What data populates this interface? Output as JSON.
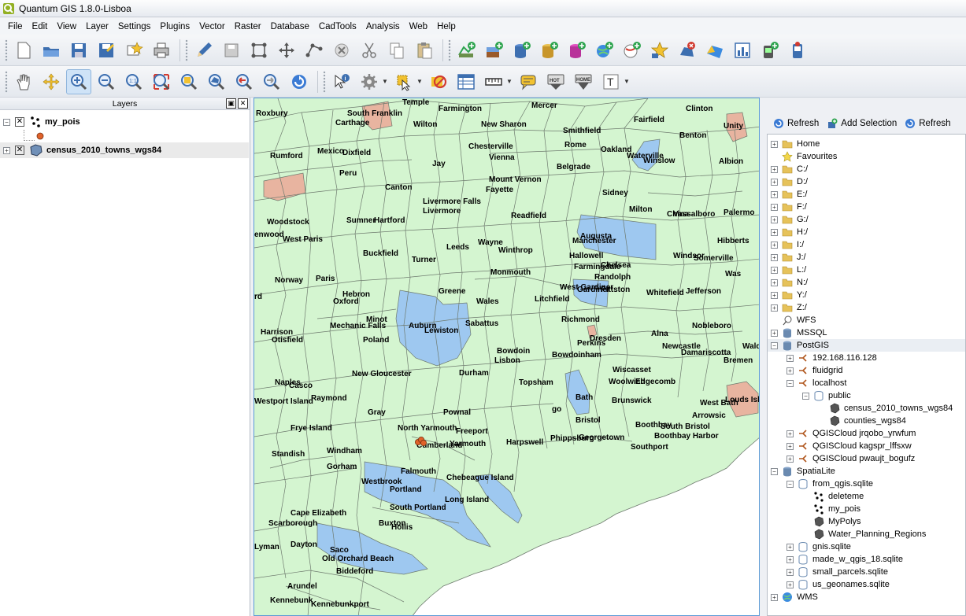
{
  "window": {
    "title": "Quantum GIS 1.8.0-Lisboa"
  },
  "menu": [
    "File",
    "Edit",
    "View",
    "Layer",
    "Settings",
    "Plugins",
    "Vector",
    "Raster",
    "Database",
    "CadTools",
    "Analysis",
    "Web",
    "Help"
  ],
  "toolbar1": [
    "new-project-icon",
    "open-project-icon",
    "save-project-icon",
    "save-as-icon",
    "new-print-composer-icon",
    "print-icon",
    "toggle-editing-icon",
    "save-edits-icon",
    "add-feature-icon",
    "move-feature-icon",
    "node-tool-icon",
    "delete-selected-icon",
    "cut-features-icon",
    "copy-features-icon",
    "paste-features-icon",
    "add-vector-layer-icon",
    "add-raster-layer-icon",
    "add-postgis-layer-icon",
    "add-spatialite-layer-icon",
    "add-mssql-layer-icon",
    "add-wms-layer-icon",
    "add-wfs-layer-icon",
    "new-shapefile-icon",
    "remove-layer-icon",
    "add-delimited-text-icon",
    "add-csv-layer-icon",
    "add-gps-layer-icon",
    "gps-tools-icon"
  ],
  "toolbar2": [
    "pan-icon",
    "pan-to-selection-icon",
    "zoom-in-icon",
    "zoom-out-icon",
    "zoom-actual-icon",
    "zoom-full-icon",
    "zoom-to-selection-icon",
    "zoom-to-layer-icon",
    "zoom-last-icon",
    "zoom-next-icon",
    "refresh-icon",
    "identify-icon",
    "actions-icon",
    "select-icon",
    "deselect-icon",
    "attribute-table-icon",
    "measure-icon",
    "annotation-icon",
    "map-tips-icon",
    "new-bookmark-icon",
    "text-annotation-icon"
  ],
  "layers_panel": {
    "title": "Layers",
    "layers": [
      {
        "name": "my_pois",
        "visible": true,
        "geometry": "point"
      },
      {
        "name": "census_2010_towns_wgs84",
        "visible": true,
        "geometry": "polygon"
      }
    ]
  },
  "browser": {
    "toolbar": [
      "Refresh",
      "Add Selection",
      "Refresh"
    ],
    "items": [
      {
        "label": "Home",
        "icon": "folder-icon",
        "depth": 0,
        "expander": "+"
      },
      {
        "label": "Favourites",
        "icon": "star-icon",
        "depth": 0,
        "expander": ""
      },
      {
        "label": "C:/",
        "icon": "folder-icon",
        "depth": 0,
        "expander": "+"
      },
      {
        "label": "D:/",
        "icon": "folder-icon",
        "depth": 0,
        "expander": "+"
      },
      {
        "label": "E:/",
        "icon": "folder-icon",
        "depth": 0,
        "expander": "+"
      },
      {
        "label": "F:/",
        "icon": "folder-icon",
        "depth": 0,
        "expander": "+"
      },
      {
        "label": "G:/",
        "icon": "folder-icon",
        "depth": 0,
        "expander": "+"
      },
      {
        "label": "H:/",
        "icon": "folder-icon",
        "depth": 0,
        "expander": "+"
      },
      {
        "label": "I:/",
        "icon": "folder-icon",
        "depth": 0,
        "expander": "+"
      },
      {
        "label": "J:/",
        "icon": "folder-icon",
        "depth": 0,
        "expander": "+"
      },
      {
        "label": "L:/",
        "icon": "folder-icon",
        "depth": 0,
        "expander": "+"
      },
      {
        "label": "N:/",
        "icon": "folder-icon",
        "depth": 0,
        "expander": "+"
      },
      {
        "label": "Y:/",
        "icon": "folder-icon",
        "depth": 0,
        "expander": "+"
      },
      {
        "label": "Z:/",
        "icon": "folder-icon",
        "depth": 0,
        "expander": "+"
      },
      {
        "label": "WFS",
        "icon": "wfs-icon",
        "depth": 0,
        "expander": ""
      },
      {
        "label": "MSSQL",
        "icon": "database-icon",
        "depth": 0,
        "expander": "+"
      },
      {
        "label": "PostGIS",
        "icon": "database-icon",
        "depth": 0,
        "expander": "-",
        "selected": true
      },
      {
        "label": "192.168.116.128",
        "icon": "connection-icon",
        "depth": 1,
        "expander": "+"
      },
      {
        "label": "fluidgrid",
        "icon": "connection-icon",
        "depth": 1,
        "expander": "+"
      },
      {
        "label": "localhost",
        "icon": "connection-icon",
        "depth": 1,
        "expander": "-"
      },
      {
        "label": "public",
        "icon": "schema-icon",
        "depth": 2,
        "expander": "-"
      },
      {
        "label": "census_2010_towns_wgs84",
        "icon": "polygon-layer-icon",
        "depth": 3,
        "expander": ""
      },
      {
        "label": "counties_wgs84",
        "icon": "polygon-layer-icon",
        "depth": 3,
        "expander": ""
      },
      {
        "label": "QGISCloud jrqobo_yrwfum",
        "icon": "connection-icon",
        "depth": 1,
        "expander": "+"
      },
      {
        "label": "QGISCloud kagspr_lffsxw",
        "icon": "connection-icon",
        "depth": 1,
        "expander": "+"
      },
      {
        "label": "QGISCloud pwaujt_bogufz",
        "icon": "connection-icon",
        "depth": 1,
        "expander": "+"
      },
      {
        "label": "SpatiaLite",
        "icon": "database-icon",
        "depth": 0,
        "expander": "-"
      },
      {
        "label": "from_qgis.sqlite",
        "icon": "schema-icon",
        "depth": 1,
        "expander": "-"
      },
      {
        "label": "deleteme",
        "icon": "point-layer-icon",
        "depth": 2,
        "expander": ""
      },
      {
        "label": "my_pois",
        "icon": "point-layer-icon",
        "depth": 2,
        "expander": ""
      },
      {
        "label": "MyPolys",
        "icon": "polygon-layer-icon",
        "depth": 2,
        "expander": ""
      },
      {
        "label": "Water_Planning_Regions",
        "icon": "polygon-layer-icon",
        "depth": 2,
        "expander": ""
      },
      {
        "label": "gnis.sqlite",
        "icon": "schema-icon",
        "depth": 1,
        "expander": "+"
      },
      {
        "label": "made_w_qgis_18.sqlite",
        "icon": "schema-icon",
        "depth": 1,
        "expander": "+"
      },
      {
        "label": "small_parcels.sqlite",
        "icon": "schema-icon",
        "depth": 1,
        "expander": "+"
      },
      {
        "label": "us_geonames.sqlite",
        "icon": "schema-icon",
        "depth": 1,
        "expander": "+"
      },
      {
        "label": "WMS",
        "icon": "globe-icon",
        "depth": 0,
        "expander": "+"
      }
    ]
  },
  "map": {
    "colors": {
      "land": "#d4f5d0",
      "water": "#9ec8f0",
      "highlight": "#e8b4a0",
      "ocean": "#ffffff",
      "border": "#6e7a6e",
      "poi": "#e0622a"
    },
    "towns": [
      "Roxbury",
      "Temple",
      "South Franklin",
      "Carthage",
      "Farmington",
      "Wilton",
      "Mercer",
      "New Sharon",
      "Clinton",
      "Fairfield",
      "Unity",
      "Smithfield",
      "Benton",
      "Rome",
      "Oakland",
      "Waterville",
      "Winslow",
      "Albion",
      "Rumford",
      "Mexico",
      "Dixfield",
      "Chesterville",
      "Vienna",
      "Jay",
      "Belgrade",
      "Peru",
      "Mount Vernon",
      "Fayette",
      "Canton",
      "Sidney",
      "Milton",
      "Livermore Falls",
      "Livermore",
      "Vassalboro",
      "China",
      "Palermo",
      "Woodstock",
      "Sumner",
      "Hartford",
      "Readfield",
      "Augusta",
      "enwood",
      "West Paris",
      "Hibberts",
      "Manchester",
      "Wayne",
      "Winthrop",
      "Leeds",
      "Buckfield",
      "Hallowell",
      "Windsor",
      "Somerville",
      "Turner",
      "Chelsea",
      "Farmingdale",
      "Randolph",
      "Monmouth",
      "Was",
      "Norway",
      "Paris",
      "West Gardiner",
      "Gardiner",
      "Pittston",
      "Litchfield",
      "Whitefield",
      "Jefferson",
      "rd",
      "Greene",
      "Hebron",
      "Oxford",
      "Wales",
      "Minot",
      "Auburn",
      "Sabattus",
      "Richmond",
      "Nobleboro",
      "Harrison",
      "Mechanic Falls",
      "Otisfield",
      "Lewiston",
      "Dresden",
      "Alna",
      "Poland",
      "Perkins",
      "Newcastle",
      "Damariscotta",
      "Wald",
      "Bowdoin",
      "Bowdoinham",
      "Lisbon",
      "Bremen",
      "New Gloucester",
      "Durham",
      "Wiscasset",
      "Topsham",
      "Woolwich",
      "Edgecomb",
      "Naples",
      "Casco",
      "Raymond",
      "Bath",
      "Louds Islan",
      "Brunswick",
      "Westport Island",
      "go",
      "West Bath",
      "Bristol",
      "Arrowsic",
      "Gray",
      "Pownal",
      "South Bristol",
      "Boothbay",
      "Frye Island",
      "North Yarmouth",
      "Freeport",
      "Boothbay Harbor",
      "Georgetown",
      "Phippsburg",
      "Cumberland",
      "Yarmouth",
      "Southport",
      "Harpswell",
      "Standish",
      "Windham",
      "Gorham",
      "Falmouth",
      "Westbrook",
      "Chebeague Island",
      "Portland",
      "Long Island",
      "South Portland",
      "Buxton",
      "Hollis",
      "Cape Elizabeth",
      "Scarborough",
      "Dayton",
      "Lyman",
      "Saco",
      "Old Orchard Beach",
      "Biddeford",
      "Arundel",
      "Kennebunk",
      "Kennebunkport"
    ],
    "poi_count": 3
  }
}
